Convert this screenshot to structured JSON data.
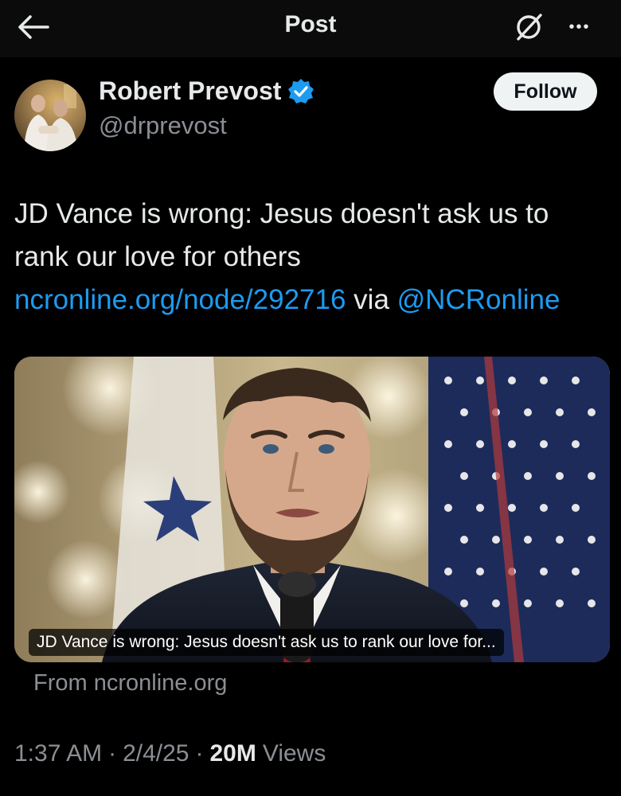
{
  "topbar": {
    "title": "Post",
    "back_icon": "arrow-left-icon",
    "grok_icon": "grok-icon",
    "more_icon": "more-horizontal-icon",
    "more_glyph": "•••"
  },
  "author": {
    "display_name": "Robert Prevost",
    "handle": "@drprevost",
    "verified": true,
    "verified_color": "#1d9bf0",
    "follow_label": "Follow"
  },
  "tweet": {
    "text_before": "JD Vance is wrong: Jesus doesn't ask us to rank our love for others ",
    "link_text": "ncronline.org/node/292716",
    "text_mid": " via ",
    "mention": "@NCRonline",
    "link_color": "#1d9bf0"
  },
  "card": {
    "caption": "JD Vance is wrong: Jesus doesn't ask us to rank our love for...",
    "source": "From ncronline.org"
  },
  "meta": {
    "time": "1:37 AM",
    "date": "2/4/25",
    "views_count": "20M",
    "views_label": "Views",
    "separator": "·"
  }
}
